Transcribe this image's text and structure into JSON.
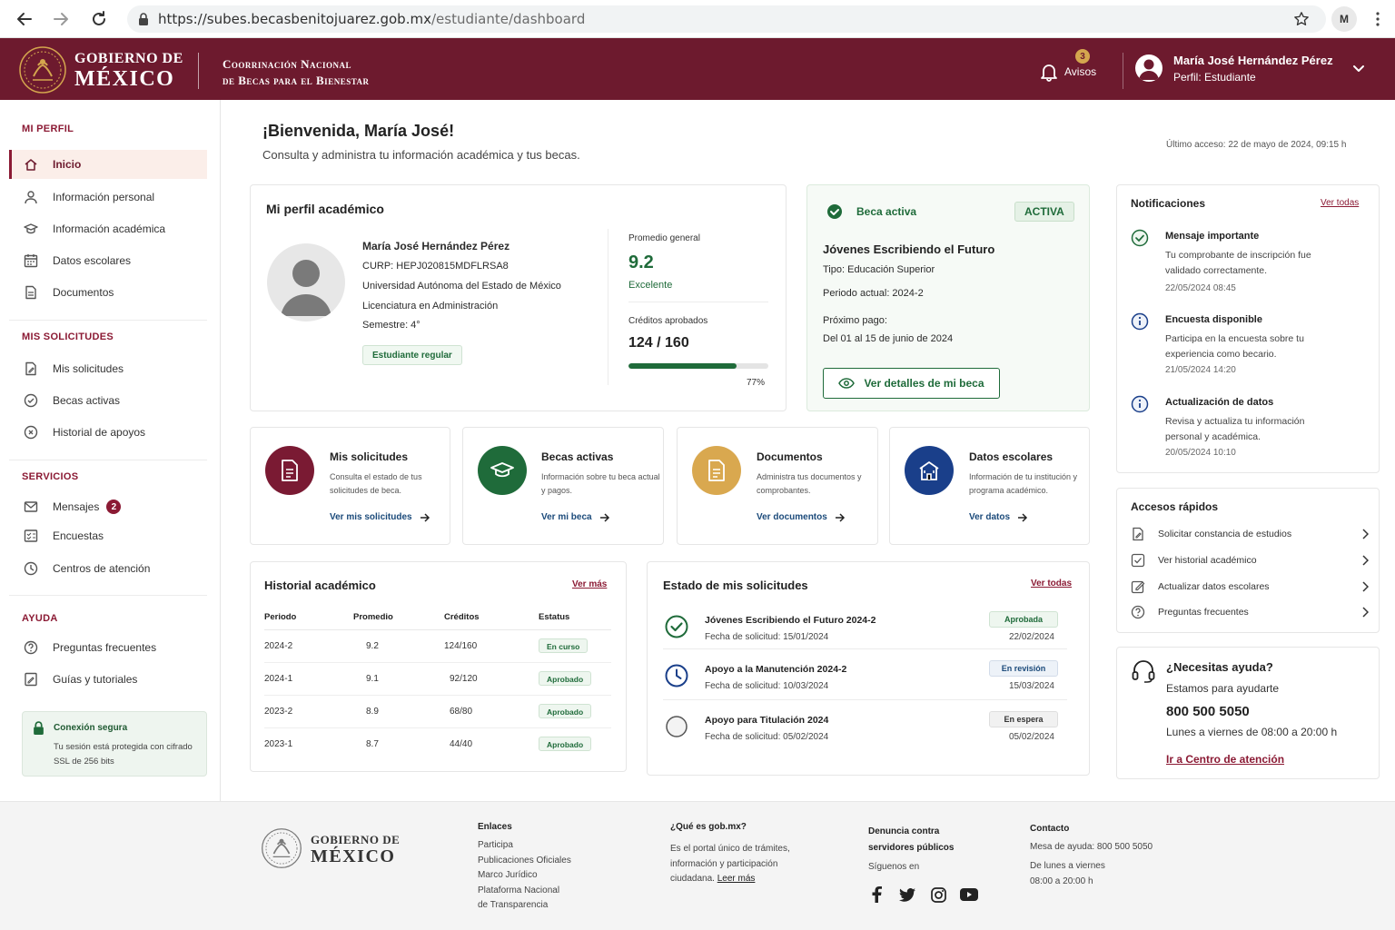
{
  "browser": {
    "url_host": "https://subes.becasbenitojuarez.gob.mx",
    "url_path": "/estudiante/dashboard",
    "profile_initial": "M"
  },
  "header": {
    "gov_line1": "GOBIERNO DE",
    "gov_line2": "MÉXICO",
    "coord_line1": "Coorrinación Nacional",
    "coord_line2": "de Becas para el Bienestar",
    "alerts_count": "3",
    "alerts_label": "Avisos",
    "user_name": "María José Hernández Pérez",
    "user_role": "Perfil: Estudiante",
    "brand_color": "#6d1a2e"
  },
  "sidebar": {
    "section_profile": "MI PERFIL",
    "profile_items": [
      {
        "label": "Inicio",
        "icon": "home-icon"
      },
      {
        "label": "Información personal",
        "icon": "user-icon"
      },
      {
        "label": "Información académica",
        "icon": "graduation-cap-icon"
      },
      {
        "label": "Datos escolares",
        "icon": "calendar-icon"
      },
      {
        "label": "Documentos",
        "icon": "document-icon"
      }
    ],
    "section_requests": "MIS SOLICITUDES",
    "request_items": [
      {
        "label": "Mis solicitudes",
        "icon": "file-edit-icon"
      },
      {
        "label": "Becas activas",
        "icon": "check-badge-icon"
      },
      {
        "label": "Historial de apoyos",
        "icon": "history-icon"
      }
    ],
    "section_services": "SERVICIOS",
    "service_items": [
      {
        "label": "Mensajes",
        "icon": "mail-icon",
        "badge": "2"
      },
      {
        "label": "Encuestas",
        "icon": "survey-icon"
      },
      {
        "label": "Centros de atención",
        "icon": "location-icon"
      }
    ],
    "section_help": "AYUDA",
    "help_items": [
      {
        "label": "Preguntas frecuentes",
        "icon": "question-icon"
      },
      {
        "label": "Guías y tutoriales",
        "icon": "guide-icon"
      }
    ],
    "secure_title": "Conexión segura",
    "secure_text": "Tu sesión está protegida con cifrado SSL de 256 bits"
  },
  "main": {
    "welcome": "¡Bienvenida, María José!",
    "welcome_sub": "Consulta y administra tu información académica y tus becas.",
    "last_access": "Último acceso: 22 de mayo de 2024, 09:15 h"
  },
  "profile_card": {
    "title": "Mi perfil académico",
    "name": "María José Hernández Pérez",
    "curp": "CURP: HEPJ020815MDFLRSA8",
    "university": "Universidad Autónoma del Estado de México",
    "degree": "Licenciatura en Administración",
    "semester": "Semestre: 4°",
    "status_tag": "Estudiante regular",
    "avg_label": "Promedio general",
    "avg_value": "9.2",
    "avg_rating": "Excelente",
    "credits_label": "Créditos aprobados",
    "credits_value": "124 / 160",
    "credits_percent": 77,
    "credits_percent_label": "77%"
  },
  "beca_card": {
    "status_label": "Beca activa",
    "badge": "ACTIVA",
    "name": "Jóvenes Escribiendo el Futuro",
    "type": "Tipo: Educación Superior",
    "period": "Periodo actual: 2024-2",
    "next_pay_label": "Próximo pago:",
    "next_pay_value": "Del 01 al 15 de junio de 2024",
    "button": "Ver detalles de mi beca"
  },
  "quick_cards": [
    {
      "title": "Mis solicitudes",
      "desc": "Consulta el estado de tus solicitudes de beca.",
      "link": "Ver mis solicitudes",
      "color": "#7a1a33",
      "icon": "document-icon"
    },
    {
      "title": "Becas activas",
      "desc": "Información sobre tu beca actual y pagos.",
      "link": "Ver mi beca",
      "color": "#1f6b3a",
      "icon": "graduation-cap-icon"
    },
    {
      "title": "Documentos",
      "desc": "Administra tus documentos y comprobantes.",
      "link": "Ver documentos",
      "color": "#d9a84f",
      "icon": "document-icon"
    },
    {
      "title": "Datos escolares",
      "desc": "Información de tu institución y programa académico.",
      "link": "Ver datos",
      "color": "#1a3f8a",
      "icon": "school-icon"
    }
  ],
  "history": {
    "title": "Historial académico",
    "more": "Ver más",
    "headers": [
      "Periodo",
      "Promedio",
      "Créditos",
      "Estatus"
    ],
    "rows": [
      {
        "period": "2024-2",
        "avg": "9.2",
        "credits": "124/160",
        "status": "En curso"
      },
      {
        "period": "2024-1",
        "avg": "9.1",
        "credits": "92/120",
        "status": "Aprobado"
      },
      {
        "period": "2023-2",
        "avg": "8.9",
        "credits": "68/80",
        "status": "Aprobado"
      },
      {
        "period": "2023-1",
        "avg": "8.7",
        "credits": "44/40",
        "status": "Aprobado"
      }
    ]
  },
  "requests": {
    "title": "Estado de mis solicitudes",
    "all": "Ver todas",
    "items": [
      {
        "name": "Jóvenes Escribiendo el Futuro 2024-2",
        "date": "Fecha de solicitud: 15/01/2024",
        "status": "Aprobada",
        "status_date": "22/02/2024",
        "icon": "check-circle-icon"
      },
      {
        "name": "Apoyo a la Manutención 2024-2",
        "date": "Fecha de solicitud: 10/03/2024",
        "status": "En revisión",
        "status_date": "15/03/2024",
        "icon": "clock-icon"
      },
      {
        "name": "Apoyo para Titulación 2024",
        "date": "Fecha de solicitud: 05/02/2024",
        "status": "En espera",
        "status_date": "05/02/2024",
        "icon": "empty-circle-icon"
      }
    ]
  },
  "notifications": {
    "title": "Notificaciones",
    "all": "Ver todas",
    "items": [
      {
        "title": "Mensaje importante",
        "text": "Tu comprobante de inscripción fue validado correctamente.",
        "date": "22/05/2024 08:45",
        "icon": "check-circle-icon"
      },
      {
        "title": "Encuesta disponible",
        "text": "Participa en la encuesta sobre tu experiencia como becario.",
        "date": "21/05/2024 14:20",
        "icon": "info-icon"
      },
      {
        "title": "Actualización de datos",
        "text": "Revisa y actualiza tu información personal y académica.",
        "date": "20/05/2024 10:10",
        "icon": "info-icon"
      }
    ]
  },
  "quick_access": {
    "title": "Accesos rápidos",
    "items": [
      {
        "label": "Solicitar constancia de estudios",
        "icon": "file-edit-icon"
      },
      {
        "label": "Ver historial académico",
        "icon": "check-square-icon"
      },
      {
        "label": "Actualizar datos escolares",
        "icon": "edit-icon"
      },
      {
        "label": "Preguntas frecuentes",
        "icon": "question-icon"
      }
    ]
  },
  "help": {
    "title": "¿Necesitas ayuda?",
    "sub": "Estamos para ayudarte",
    "phone": "800 500 5050",
    "hours": "Lunes a viernes de 08:00 a 20:00 h",
    "link": "Ir a Centro de atención"
  },
  "footer": {
    "gov_line1": "GOBIERNO DE",
    "gov_line2": "MÉXICO",
    "links_title": "Enlaces",
    "links": [
      "Participa",
      "Publicaciones Oficiales",
      "Marco Jurídico",
      "Plataforma Nacional",
      "de Transparencia"
    ],
    "what_title": "¿Qué es gob.mx?",
    "what_text": "Es el portal único de trámites, información y participación ciudadana.",
    "what_link": "Leer más",
    "report_title_1": "Denuncia contra",
    "report_title_2": "servidores públicos",
    "follow": "Síguenos en",
    "contact_title": "Contacto",
    "contact_phone": "Mesa de ayuda: 800 500 5050",
    "contact_hours_1": "De lunes a viernes",
    "contact_hours_2": "08:00 a 20:00 h"
  }
}
